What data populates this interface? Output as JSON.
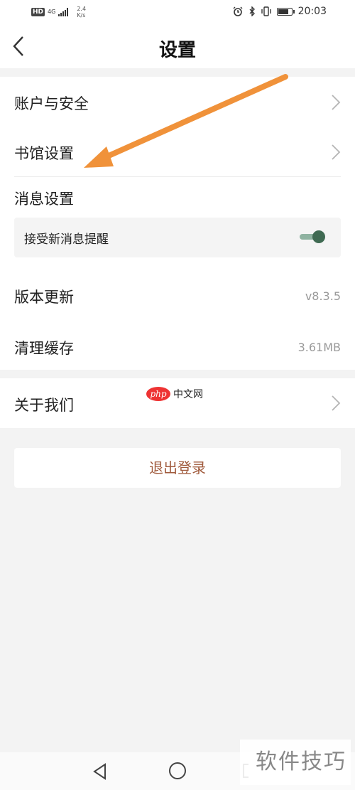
{
  "status_bar": {
    "network_badge": "HD",
    "signal_type": "4G",
    "speed_value": "2.4",
    "speed_unit": "K/s",
    "time": "20:03"
  },
  "header": {
    "title": "设置"
  },
  "settings": {
    "account_security": "账户与安全",
    "library_settings": "书馆设置",
    "message_settings": "消息设置",
    "receive_new_message": "接受新消息提醒",
    "receive_new_message_enabled": true,
    "version_update": "版本更新",
    "version_value": "v8.3.5",
    "clear_cache": "清理缓存",
    "cache_value": "3.61MB",
    "about_us": "关于我们"
  },
  "logout_label": "退出登录",
  "watermarks": {
    "php_site": "php",
    "php_site_text": "中文网",
    "tips": "软件技巧"
  },
  "colors": {
    "accent_logout": "#a05a3c",
    "toggle_on": "#3f6a52",
    "annotation_arrow": "#f0923a"
  },
  "icons": [
    "back-icon",
    "chevron-right-icon",
    "nav-back-icon",
    "nav-home-icon",
    "nav-recent-icon"
  ]
}
